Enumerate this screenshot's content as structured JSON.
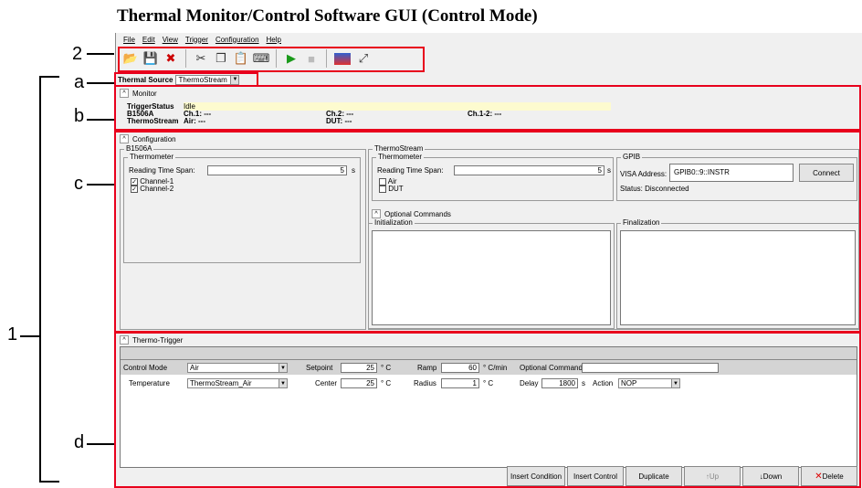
{
  "title": "Thermal Monitor/Control Software GUI (Control Mode)",
  "callouts": {
    "n2": "2",
    "a": "a",
    "b": "b",
    "c": "c",
    "n1": "1",
    "d": "d"
  },
  "menu": [
    "File",
    "Edit",
    "View",
    "Trigger",
    "Configuration",
    "Help"
  ],
  "toolbar_icons": [
    "open-icon",
    "save-icon",
    "delete-file-icon",
    "cut-icon",
    "copy-icon",
    "paste-icon",
    "keyboard-icon",
    "run-icon",
    "stop-icon",
    "monitor-icon",
    "expand-icon"
  ],
  "source": {
    "label": "Thermal Source",
    "value": "ThermoStream"
  },
  "monitor": {
    "header": "Monitor",
    "trigger_label": "TriggerStatus",
    "trigger_value": "Idle",
    "b1506a": "B1506A",
    "ch1": "Ch.1: ---",
    "ch2": "Ch.2: ---",
    "ch12": "Ch.1-2: ---",
    "thermostream": "ThermoStream",
    "air": "Air: ---",
    "dut": "DUT: ---"
  },
  "config": {
    "header": "Configuration",
    "b1506a": "B1506A",
    "thermometer": "Thermometer",
    "span_label": "Reading Time Span:",
    "span_value": "5",
    "span_unit": "s",
    "ch1": "Channel-1",
    "ch2": "Channel-2",
    "ts": "ThermoStream",
    "ts_thermometer": "Thermometer",
    "ts_span_label": "Reading Time Span:",
    "ts_span_value": "5",
    "ts_span_unit": "s",
    "air": "Air",
    "dut": "DUT",
    "gpib": "GPIB",
    "visa_label": "VISA Address:",
    "visa_value": "GPIB0::9::INSTR",
    "connect": "Connect",
    "status": "Status: Disconnected",
    "optional": "Optional Commands",
    "init": "Initialization",
    "final": "Finalization"
  },
  "trigger": {
    "header": "Thermo-Trigger",
    "control_mode_label": "Control Mode",
    "control_mode": "Air",
    "setpoint_label": "Setpoint",
    "setpoint": "25",
    "c1": "° C",
    "ramp_label": "Ramp",
    "ramp": "60",
    "ramp_unit": "° C/min",
    "optional_label": "Optional Command",
    "temperature_label": "Temperature",
    "temperature": "ThermoStream_Air",
    "center_label": "Center",
    "center": "25",
    "c2": "° C",
    "radius_label": "Radius",
    "radius": "1",
    "c3": "° C",
    "delay_label": "Delay",
    "delay": "1800",
    "delay_unit": "s",
    "action_label": "Action",
    "action": "NOP"
  },
  "buttons": {
    "insert_condition": "Insert Condition",
    "insert_control": "Insert Control",
    "duplicate": "Duplicate",
    "up": "Up",
    "down": "Down",
    "delete": "Delete"
  },
  "colors": {
    "red": "#e8001c",
    "status_bg": "#fdfbcf"
  }
}
